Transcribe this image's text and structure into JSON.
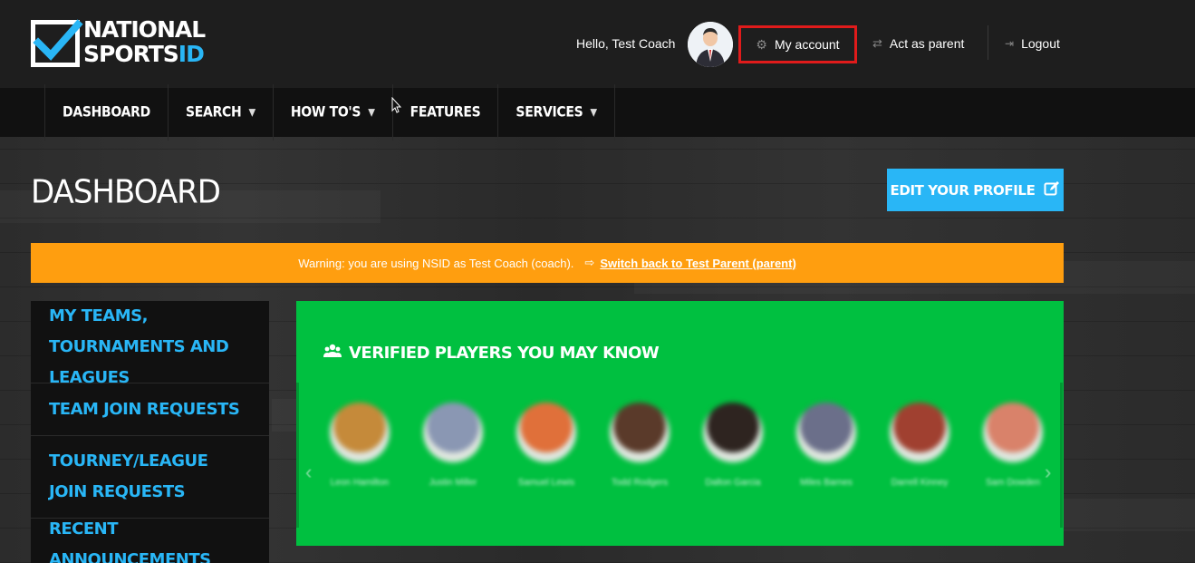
{
  "header": {
    "logo_line1": "NATIONAL",
    "logo_line2_part1": "SPORTS",
    "logo_line2_part2": "ID",
    "greeting": "Hello, Test Coach",
    "my_account": "My account",
    "act_as_parent": "Act as parent",
    "logout": "Logout"
  },
  "nav": {
    "items": [
      {
        "label": "DASHBOARD",
        "dropdown": false
      },
      {
        "label": "SEARCH",
        "dropdown": true
      },
      {
        "label": "HOW TO'S",
        "dropdown": true
      },
      {
        "label": "FEATURES",
        "dropdown": false
      },
      {
        "label": "SERVICES",
        "dropdown": true
      }
    ]
  },
  "page": {
    "title": "DASHBOARD",
    "edit_profile": "EDIT YOUR PROFILE"
  },
  "warning": {
    "text": "Warning: you are using NSID as Test Coach (coach).",
    "link": "Switch back to Test Parent (parent)"
  },
  "sidebar": {
    "items": [
      {
        "label": "MY TEAMS, TOURNAMENTS AND LEAGUES"
      },
      {
        "label": "TEAM JOIN REQUESTS"
      },
      {
        "label": "TOURNEY/LEAGUE JOIN REQUESTS"
      },
      {
        "label": "RECENT ANNOUNCEMENTS"
      }
    ]
  },
  "verified": {
    "title": "VERIFIED PLAYERS YOU MAY KNOW",
    "players": [
      {
        "name": "Leon Hamilton",
        "color": "#c58a3a"
      },
      {
        "name": "Justin Miller",
        "color": "#8a97b3"
      },
      {
        "name": "Samuel Lewis",
        "color": "#e0703a"
      },
      {
        "name": "Todd Rodgers",
        "color": "#5a3a2a"
      },
      {
        "name": "Dalton Garcia",
        "color": "#2e2420"
      },
      {
        "name": "Miles Barnes",
        "color": "#6b6f8a"
      },
      {
        "name": "Darrell Kinney",
        "color": "#a04030"
      },
      {
        "name": "Sam Dowden",
        "color": "#d9826a"
      }
    ]
  },
  "colors": {
    "accent": "#29b6f6",
    "warning": "#ff9e0f",
    "panel": "#00c040",
    "highlight": "#e01b1b"
  }
}
